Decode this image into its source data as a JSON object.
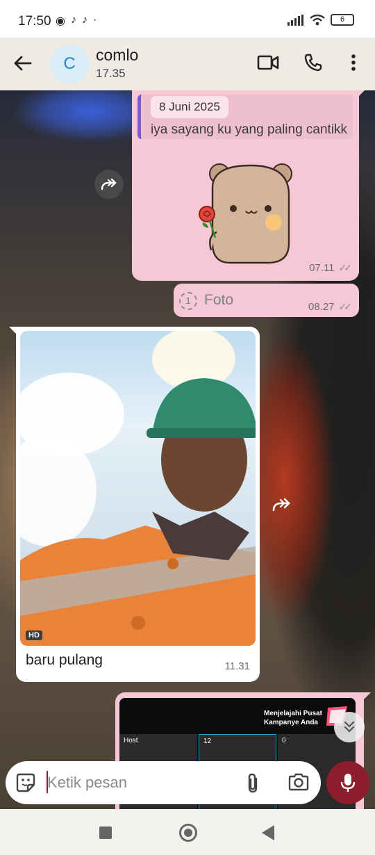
{
  "status_bar": {
    "time": "17:50",
    "battery": "6"
  },
  "header": {
    "avatar_letter": "C",
    "contact_name": "comlo",
    "last_seen": "17.35"
  },
  "messages": {
    "sticker_message": {
      "quote_date": "8 Juni 2025",
      "quote_text": "iya sayang ku yang paling cantikk",
      "time": "07.11"
    },
    "view_once_photo": {
      "once_label": "1",
      "label": "Foto",
      "time": "08.27"
    },
    "photo_message": {
      "hd_badge": "HD",
      "caption": "baru pulang",
      "time": "11.31"
    },
    "screenshot_message": {
      "title": "Menjelajahi Pusat Kampanye Anda",
      "card_labels": [
        "Host",
        "12",
        "0"
      ]
    }
  },
  "input": {
    "placeholder": "Ketik pesan"
  },
  "colors": {
    "outgoing_bubble": "#f6c8d6",
    "incoming_bubble": "#ffffff",
    "header_bg": "#efebe4",
    "mic_button": "#8b1d2c",
    "avatar_bg": "#d9ecf7",
    "quote_bar": "#7d5ad8"
  },
  "icons": {
    "back": "back-arrow-icon",
    "video_call": "video-camera-icon",
    "voice_call": "phone-icon",
    "menu": "more-vertical-icon",
    "forward": "forward-icon",
    "scroll_down": "double-chevron-down-icon",
    "emoji": "sticker-icon",
    "attach": "paperclip-icon",
    "camera": "camera-icon",
    "mic": "microphone-icon"
  }
}
